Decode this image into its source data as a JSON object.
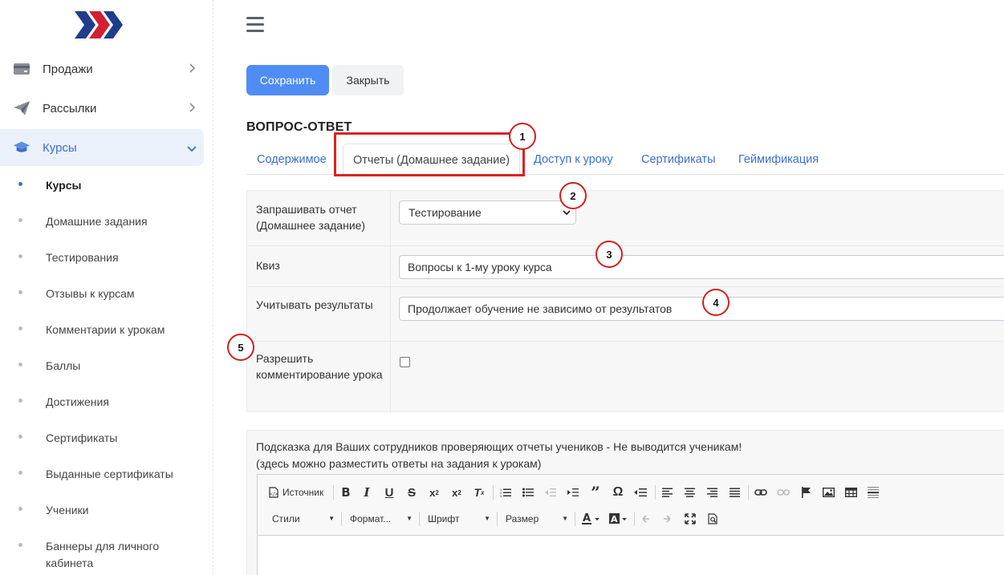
{
  "sidebar": {
    "menu": [
      {
        "label": "Продажи",
        "icon": "card-icon"
      },
      {
        "label": "Рассылки",
        "icon": "paper-plane-icon"
      },
      {
        "label": "Курсы",
        "icon": "graduation-cap-icon"
      }
    ],
    "sub_items": [
      {
        "label": "Курсы"
      },
      {
        "label": "Домашние задания"
      },
      {
        "label": "Тестирования"
      },
      {
        "label": "Отзывы к курсам"
      },
      {
        "label": "Комментарии к урокам"
      },
      {
        "label": "Баллы"
      },
      {
        "label": "Достижения"
      },
      {
        "label": "Сертификаты"
      },
      {
        "label": "Выданные сертификаты"
      },
      {
        "label": "Ученики"
      },
      {
        "label": "Баннеры для личного кабинета"
      }
    ],
    "active_menu": "Курсы",
    "active_sub": "Курсы"
  },
  "toolbar": {
    "save_label": "Сохранить",
    "close_label": "Закрыть"
  },
  "section_title": "ВОПРОС-ОТВЕТ",
  "tabs": [
    {
      "label": "Содержимое"
    },
    {
      "label": "Отчеты (Домашнее задание)"
    },
    {
      "label": "Доступ к уроку"
    },
    {
      "label": "Сертификаты"
    },
    {
      "label": "Геймификация"
    }
  ],
  "active_tab": "Отчеты (Домашнее задание)",
  "form": {
    "request_report": {
      "label": "Запрашивать отчет (Домашнее задание)",
      "value": "Тестирование"
    },
    "quiz": {
      "label": "Квиз",
      "value": "Вопросы к 1-му уроку курса"
    },
    "consider_results": {
      "label": "Учитывать результаты",
      "value": "Продолжает обучение не зависимо от результатов"
    },
    "allow_comments": {
      "label": "Разрешить комментирование урока",
      "checked": false
    }
  },
  "hint": {
    "line1": "Подсказка для Ваших сотрудников проверяющих отчеты учеников - Не выводится ученикам!",
    "line2": "(здесь можно разместить ответы на задания к урокам)"
  },
  "editor": {
    "source_label": "Источник",
    "styles_label": "Стили",
    "format_label": "Формат...",
    "font_label": "Шрифт",
    "size_label": "Размер"
  },
  "annotations": [
    "1",
    "2",
    "3",
    "4",
    "5"
  ],
  "colors": {
    "accent": "#4f8df5",
    "link": "#3b6fd0",
    "annotation": "#d11f1f"
  }
}
